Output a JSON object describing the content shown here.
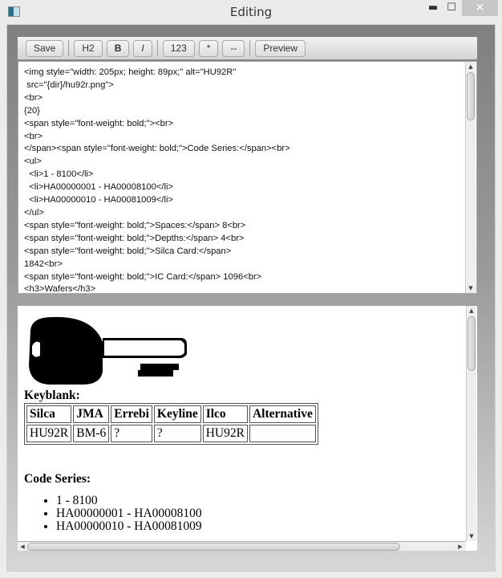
{
  "window": {
    "title": "Editing",
    "minimize": "▬",
    "maximize": "☐",
    "close": "✕"
  },
  "toolbar": {
    "save": "Save",
    "h2": "H2",
    "bold": "B",
    "italic": "I",
    "numbered": "123",
    "bullet": "*",
    "hr": "--",
    "preview": "Preview"
  },
  "editor": {
    "content": "<img style=\"width: 205px; height: 89px;\" alt=\"HU92R\"\n src=\"{dir}/hu92r.png\">\n<br>\n{20}\n<span style=\"font-weight: bold;\"><br>\n<br>\n</span><span style=\"font-weight: bold;\">Code Series:</span><br>\n<ul>\n  <li>1 - 8100</li>\n  <li>HA00000001 - HA00008100</li>\n  <li>HA00000010 - HA00081009</li>\n</ul>\n<span style=\"font-weight: bold;\">Spaces:</span> 8<br>\n<span style=\"font-weight: bold;\">Depths:</span> 4<br>\n<span style=\"font-weight: bold;\">Silca Card:</span>\n1842<br>\n<span style=\"font-weight: bold;\">IC Card:</span> 1096<br>\n<h3>Wafers</h3>"
  },
  "preview": {
    "image_alt": "HU92R",
    "keyblank_label": "Keyblank:",
    "table": {
      "headers": [
        "Silca",
        "JMA",
        "Errebi",
        "Keyline",
        "Ilco",
        "Alternative"
      ],
      "row": [
        "HU92R",
        "BM-6",
        "?",
        "?",
        "HU92R",
        ""
      ]
    },
    "code_series_label": "Code Series:",
    "code_series": [
      "1 - 8100",
      "HA00000001 - HA00008100",
      "HA00000010 - HA00081009"
    ]
  }
}
